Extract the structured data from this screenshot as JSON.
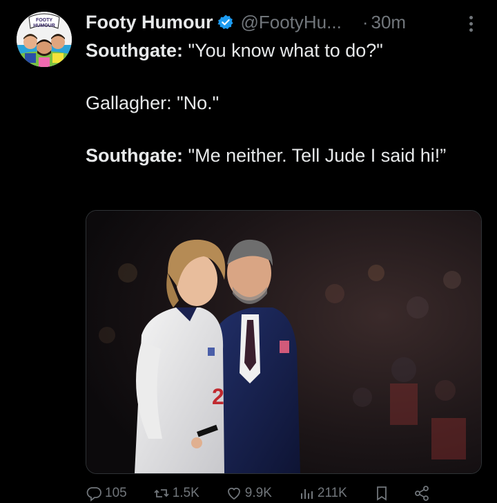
{
  "tweet": {
    "avatar_text_line1": "FOOTY",
    "avatar_text_line2": "HUMOUR",
    "display_name": "Footy Humour",
    "handle": "@FootyHu...",
    "separator": "·",
    "time": "30m",
    "lines": [
      {
        "speaker": "Southgate",
        "quote": " \"You know what to do?\""
      },
      {
        "speaker": "",
        "quote": "Gallagher: \"No.\""
      },
      {
        "speaker": "Southgate",
        "quote": " \"Me neither. Tell Jude I said hi!”"
      }
    ],
    "colon": ":",
    "image_icon": "photo",
    "actions": {
      "reply_count": "105",
      "retweet_count": "1.5K",
      "like_count": "9.9K",
      "views_count": "211K"
    },
    "colors": {
      "verified": "#1d9bf0",
      "text": "#e7e9ea",
      "muted": "#71767b"
    }
  }
}
